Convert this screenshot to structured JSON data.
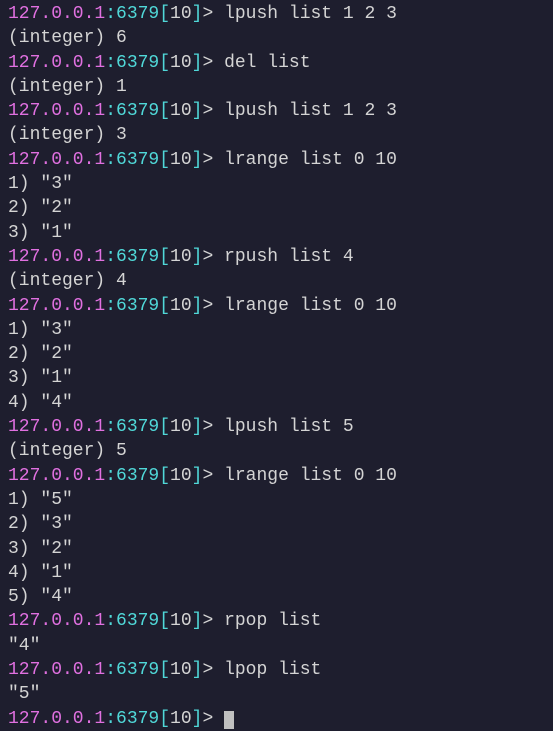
{
  "prompt": {
    "host": "127.0.0.1",
    "port": ":6379",
    "open_bracket": "[",
    "db": "10",
    "close_bracket": "]",
    "arrow": "> "
  },
  "lines": [
    {
      "type": "cmd",
      "text": "lpush list 1 2 3"
    },
    {
      "type": "out",
      "text": "(integer) 6"
    },
    {
      "type": "cmd",
      "text": "del list"
    },
    {
      "type": "out",
      "text": "(integer) 1"
    },
    {
      "type": "cmd",
      "text": "lpush list 1 2 3"
    },
    {
      "type": "out",
      "text": "(integer) 3"
    },
    {
      "type": "cmd",
      "text": "lrange list 0 10"
    },
    {
      "type": "out",
      "text": "1) \"3\""
    },
    {
      "type": "out",
      "text": "2) \"2\""
    },
    {
      "type": "out",
      "text": "3) \"1\""
    },
    {
      "type": "cmd",
      "text": "rpush list 4"
    },
    {
      "type": "out",
      "text": "(integer) 4"
    },
    {
      "type": "cmd",
      "text": "lrange list 0 10"
    },
    {
      "type": "out",
      "text": "1) \"3\""
    },
    {
      "type": "out",
      "text": "2) \"2\""
    },
    {
      "type": "out",
      "text": "3) \"1\""
    },
    {
      "type": "out",
      "text": "4) \"4\""
    },
    {
      "type": "cmd",
      "text": "lpush list 5"
    },
    {
      "type": "out",
      "text": "(integer) 5"
    },
    {
      "type": "cmd",
      "text": "lrange list 0 10"
    },
    {
      "type": "out",
      "text": "1) \"5\""
    },
    {
      "type": "out",
      "text": "2) \"3\""
    },
    {
      "type": "out",
      "text": "3) \"2\""
    },
    {
      "type": "out",
      "text": "4) \"1\""
    },
    {
      "type": "out",
      "text": "5) \"4\""
    },
    {
      "type": "cmd",
      "text": "rpop list"
    },
    {
      "type": "out",
      "text": "\"4\""
    },
    {
      "type": "cmd",
      "text": "lpop list"
    },
    {
      "type": "out",
      "text": "\"5\""
    },
    {
      "type": "cursor",
      "text": ""
    }
  ]
}
